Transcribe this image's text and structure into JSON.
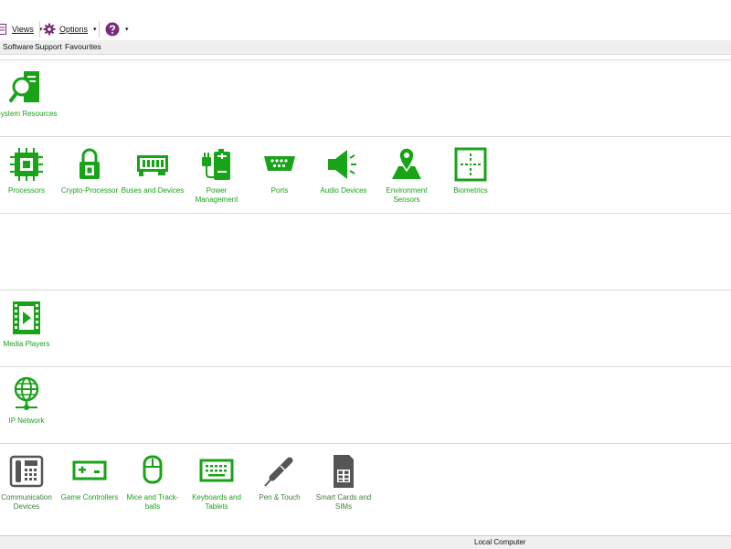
{
  "toolbar": {
    "views_label": "Views",
    "options_label": "Options",
    "dropdown_glyph": "▾"
  },
  "menu": {
    "items": [
      "Software",
      "Support",
      "Favourites"
    ]
  },
  "sections": {
    "system": [
      {
        "label": "System Resources",
        "icon": "system-resources-icon"
      }
    ],
    "hardware": [
      {
        "label": "Processors",
        "icon": "processor-chip-icon"
      },
      {
        "label": "Crypto-Processor",
        "icon": "crypto-lock-icon"
      },
      {
        "label": "Buses and Devices",
        "icon": "bus-card-icon"
      },
      {
        "label": "Power Management",
        "icon": "battery-plug-icon"
      },
      {
        "label": "Ports",
        "icon": "serial-port-icon"
      },
      {
        "label": "Audio Devices",
        "icon": "speaker-icon"
      },
      {
        "label": "Environment Sensors",
        "icon": "map-pin-icon"
      },
      {
        "label": "Biometrics",
        "icon": "biometrics-grid-icon"
      }
    ],
    "media": [
      {
        "label": "Media Players",
        "icon": "film-play-icon"
      }
    ],
    "network": [
      {
        "label": "IP Network",
        "icon": "globe-network-icon"
      }
    ],
    "devices": [
      {
        "label": "Communication Devices",
        "icon": "phone-icon"
      },
      {
        "label": "Game Controllers",
        "icon": "gamepad-icon"
      },
      {
        "label": "Mice and Track-balls",
        "icon": "mouse-icon"
      },
      {
        "label": "Keyboards and Tablets",
        "icon": "keyboard-icon"
      },
      {
        "label": "Pen & Touch",
        "icon": "pen-icon"
      },
      {
        "label": "Smart Cards and SIMs",
        "icon": "sim-card-icon"
      }
    ]
  },
  "colors": {
    "accent_green": "#19a319",
    "help_purple": "#7a2c7a",
    "icon_gray": "#555555"
  },
  "status": {
    "text": "Local Computer"
  }
}
